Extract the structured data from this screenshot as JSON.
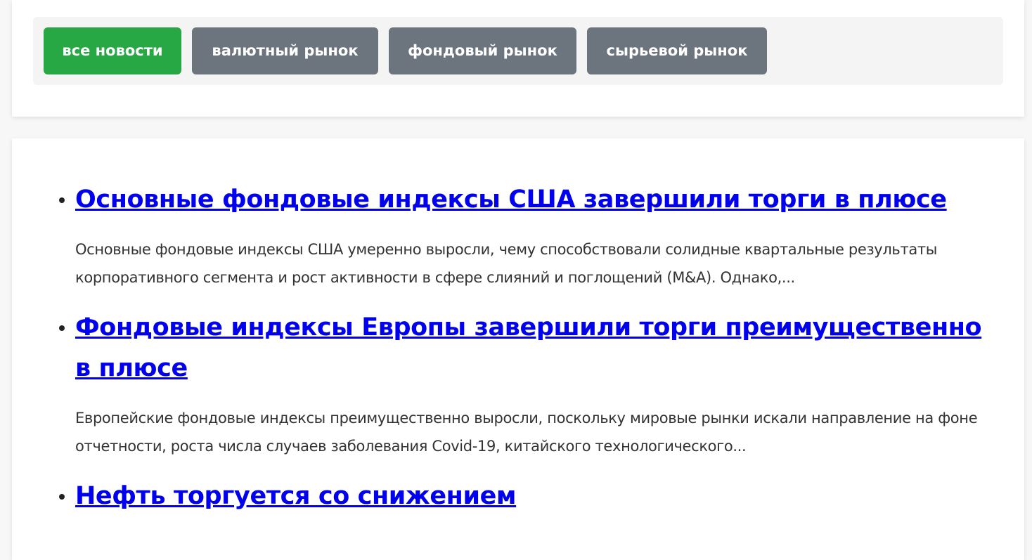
{
  "filters": {
    "all": "все новости",
    "forex": "валютный рынок",
    "stocks": "фондовый рынок",
    "commodities": "сырьевой рынок"
  },
  "colors": {
    "active_button": "#28a745",
    "secondary_button": "#6c757d",
    "link": "#0000ee"
  },
  "news": [
    {
      "title": "Основные фондовые индексы США завершили торги в плюсе",
      "excerpt": "Основные фондовые индексы США умеренно выросли, чему способствовали солидные квартальные результаты корпоративного сегмента и рост активности в сфере слияний и поглощений (M&A). Однако,..."
    },
    {
      "title": "Фондовые индексы Европы завершили торги преимущественно в плюсе",
      "excerpt": "Европейские фондовые индексы преимущественно выросли, поскольку мировые рынки искали направление на фоне отчетности, роста числа случаев заболевания Covid-19, китайского технологического..."
    },
    {
      "title": "Нефть торгуется со снижением",
      "excerpt": ""
    }
  ]
}
